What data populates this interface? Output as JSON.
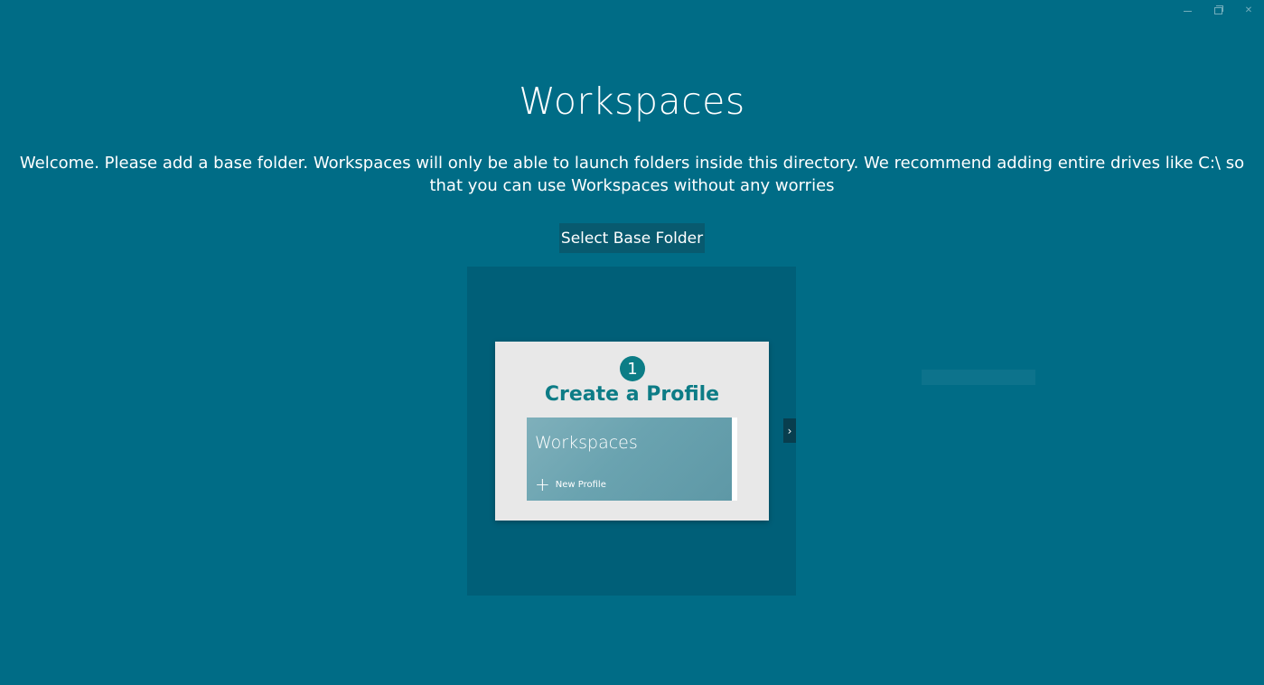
{
  "window": {
    "minimize_icon": "minimize-icon",
    "restore_icon": "restore-icon",
    "close_icon": "close-icon",
    "close_glyph": "✕"
  },
  "page": {
    "title": "Workspaces",
    "welcome": "Welcome. Please add a base folder. Workspaces will only be able to launch folders inside this directory. We recommend adding entire drives like C:\\ so that you can use Workspaces without any worries",
    "select_button": "Select Base Folder"
  },
  "flipview": {
    "slide": {
      "step_number": "1",
      "heading": "Create a Profile",
      "preview_title": "Workspaces",
      "new_profile_label": "New Profile",
      "plus_glyph": "+"
    },
    "next_glyph": "›"
  },
  "colors": {
    "background": "#006c86",
    "button": "#085a6f",
    "flipview": "#005f78",
    "accent": "#0c7d86"
  }
}
